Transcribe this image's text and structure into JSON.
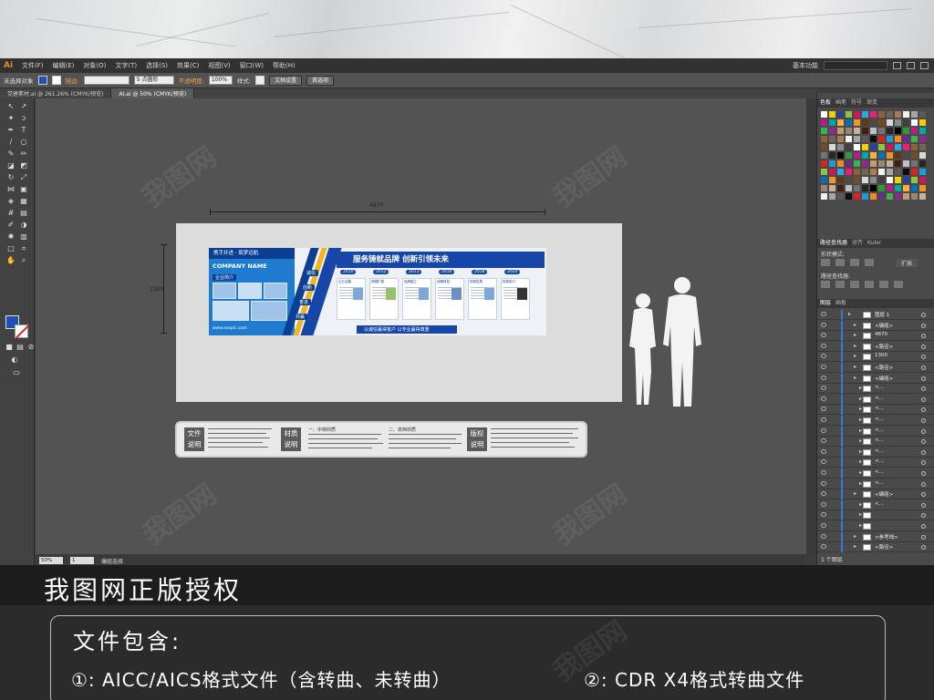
{
  "app": {
    "logo": "Ai",
    "menu": [
      "文件(F)",
      "编辑(E)",
      "对象(O)",
      "文字(T)",
      "选择(S)",
      "效果(C)",
      "视图(V)",
      "窗口(W)",
      "帮助(H)"
    ],
    "workspace": "基本功能"
  },
  "control_bar": {
    "selection": "未选择对象",
    "stroke_label": "描边:",
    "stroke_width": "5 点圆形",
    "opacity_label": "不透明度:",
    "opacity_value": "100%",
    "style_label": "样式:",
    "doc_setup": "文档设置",
    "preferences": "首选项"
  },
  "tabs": [
    {
      "label": "党建素材.ai @ 261.26% (CMYK/预览)"
    },
    {
      "label": "AI.ai @ 50% (CMYK/预览)"
    }
  ],
  "artwork": {
    "dim_width": "4870",
    "dim_height": "1500",
    "slogan": "携手并进 · 筑梦远航",
    "company": "COMPANY NAME",
    "subhead": "企业简介",
    "url": "www.xxxpic.com",
    "tags": [
      "诚信",
      "创新",
      "奋进",
      "共赢"
    ],
    "banner": "服务铸就品牌  创新引领未来",
    "years": [
      "2010",
      "2012",
      "2013",
      "2016",
      "2018",
      "2020"
    ],
    "card_titles": [
      "企业创建",
      "规模扩展",
      "品牌建立",
      "战略转型",
      "快速发展",
      "砥砺前行"
    ],
    "bottom_text": "以诚信赢得客户  以专业赢得尊重"
  },
  "legend": {
    "file_label": "文件说明",
    "material_label": "材质说明",
    "mid_low": "一、中档材质",
    "mid_high": "二、高档材质",
    "copyright_label": "版权说明"
  },
  "status": {
    "zoom": "50%",
    "page": "1",
    "tool": "编组选择"
  },
  "panels": {
    "swatch_tabs": [
      "色板",
      "画笔",
      "符号",
      "渐变"
    ],
    "path_tabs": [
      "路径查找器",
      "对齐",
      "Kuler"
    ],
    "shape_mode": "形状模式:",
    "path_finder": "路径查找器:",
    "expand": "扩展",
    "layers_tabs": [
      "图层",
      "画板"
    ],
    "layers": [
      {
        "name": "图层 1",
        "depth": 0
      },
      {
        "name": "<编组>",
        "depth": 1
      },
      {
        "name": "4870",
        "depth": 1
      },
      {
        "name": "<路径>",
        "depth": 1
      },
      {
        "name": "1300",
        "depth": 1
      },
      {
        "name": "<路径>",
        "depth": 1
      },
      {
        "name": "<编组>",
        "depth": 1
      },
      {
        "name": "<...",
        "depth": 2
      },
      {
        "name": "<...",
        "depth": 2
      },
      {
        "name": "<...",
        "depth": 2
      },
      {
        "name": "<...",
        "depth": 2
      },
      {
        "name": "<...",
        "depth": 2
      },
      {
        "name": "<...",
        "depth": 2
      },
      {
        "name": "<...",
        "depth": 2
      },
      {
        "name": "<...",
        "depth": 2
      },
      {
        "name": "<...",
        "depth": 2
      },
      {
        "name": "<...",
        "depth": 2
      },
      {
        "name": "<编组>",
        "depth": 1
      },
      {
        "name": "<...",
        "depth": 2
      },
      {
        "name": "",
        "depth": 2
      },
      {
        "name": "",
        "depth": 2
      },
      {
        "name": "<参考线>",
        "depth": 1
      },
      {
        "name": "<路径>",
        "depth": 1
      }
    ],
    "layer_count": "1 个图层"
  },
  "promo": {
    "title": "我图网正版授权",
    "head": "文件包含:",
    "item1": "①: AICC/AICS格式文件（含转曲、未转曲）",
    "item2": "②: CDR X4格式转曲文件"
  },
  "watermark": "我图网",
  "colors": {
    "accent_blue": "#1546a8",
    "panel_blue": "#1e7bd0",
    "ai_orange": "#f08a1c"
  }
}
